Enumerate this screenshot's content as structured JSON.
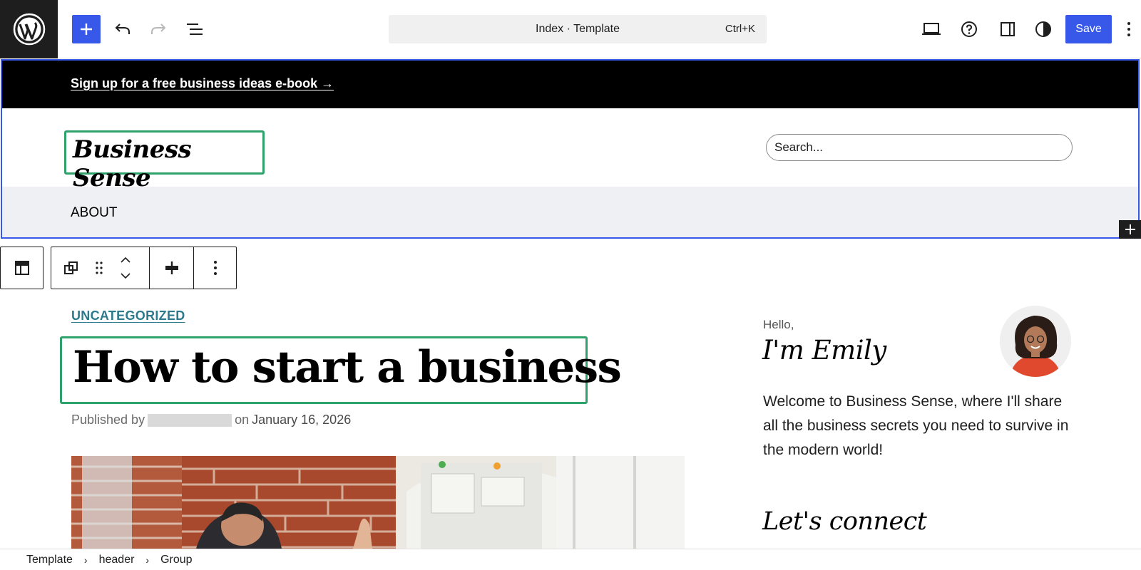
{
  "toolbar": {
    "command_label": "Index · Template",
    "command_shortcut": "Ctrl+K",
    "save_label": "Save"
  },
  "header": {
    "banner_link": "Sign up for a free business ideas e-book →",
    "site_title": "Business Sense",
    "search_placeholder": "Search...",
    "nav_items": [
      "ABOUT"
    ]
  },
  "post": {
    "category": "UNCATEGORIZED",
    "title": "How to start a business",
    "published_by": "Published by",
    "on": "on",
    "date": "January 16, 2026"
  },
  "sidebar": {
    "hello": "Hello,",
    "name": "I'm Emily",
    "welcome": "Welcome to Business Sense, where I'll share all the business secrets you need to survive in the modern world!",
    "connect": "Let's connect"
  },
  "breadcrumb": [
    "Template",
    "header",
    "Group"
  ],
  "colors": {
    "accent": "#3858e9",
    "selection": "#2ea26a",
    "category": "#2c7a8c"
  }
}
